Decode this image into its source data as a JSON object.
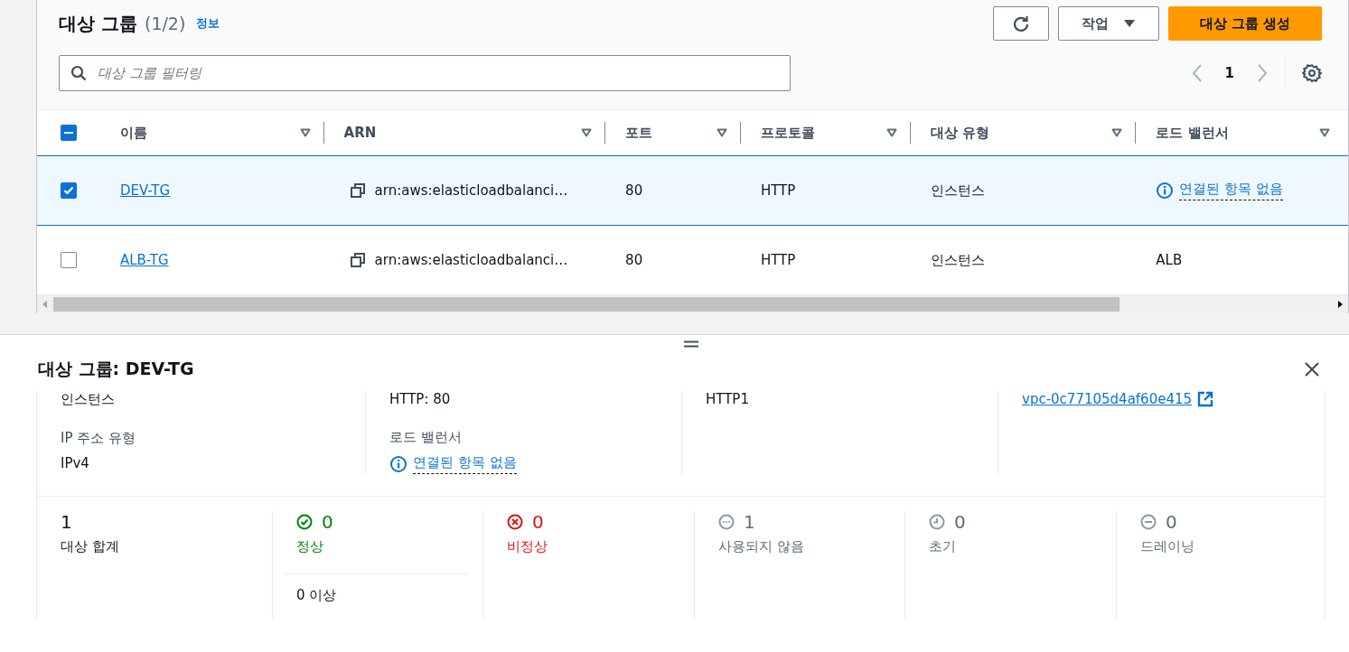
{
  "header": {
    "title": "대상 그룹",
    "count": "(1/2)",
    "info": "정보",
    "actions_button": "작업",
    "create_button": "대상 그룹 생성"
  },
  "filter": {
    "placeholder": "대상 그룹 필터링"
  },
  "pagination": {
    "page": "1",
    "prev_disabled": true,
    "next_disabled": true
  },
  "table": {
    "select_all": {
      "indeterminate": true
    },
    "columns": [
      "이름",
      "ARN",
      "포트",
      "프로토콜",
      "대상 유형",
      "로드 밸런서"
    ],
    "rows": [
      {
        "selected": true,
        "name": "DEV-TG",
        "arn": "arn:aws:elasticloadbalanci…",
        "port": "80",
        "protocol": "HTTP",
        "target_type": "인스턴스",
        "load_balancer": {
          "kind": "info-link",
          "text": "연결된 항목 없음"
        }
      },
      {
        "selected": false,
        "name": "ALB-TG",
        "arn": "arn:aws:elasticloadbalanci…",
        "port": "80",
        "protocol": "HTTP",
        "target_type": "인스턴스",
        "load_balancer": {
          "kind": "text",
          "text": "ALB"
        }
      }
    ]
  },
  "details": {
    "title": "대상 그룹: DEV-TG",
    "columns": [
      [
        {
          "kind": "text",
          "value": "인스턴스"
        },
        {
          "kind": "text",
          "label": "IP 주소 유형",
          "value": "IPv4"
        }
      ],
      [
        {
          "kind": "text",
          "value": "HTTP: 80"
        },
        {
          "kind": "info-link",
          "label": "로드 밸런서",
          "value": "연결된 항목 없음"
        }
      ],
      [
        {
          "kind": "text",
          "value": "HTTP1"
        }
      ],
      [
        {
          "kind": "external-link",
          "value": "vpc-0c77105d4af60e415"
        }
      ]
    ],
    "stats": [
      {
        "kind": "total",
        "value": "1",
        "label": "대상 합계"
      },
      {
        "kind": "healthy",
        "value": "0",
        "label": "정상",
        "sub": "0 이상"
      },
      {
        "kind": "unhealthy",
        "value": "0",
        "label": "비정상"
      },
      {
        "kind": "unused",
        "value": "1",
        "label": "사용되지 않음"
      },
      {
        "kind": "initial",
        "value": "0",
        "label": "초기"
      },
      {
        "kind": "draining",
        "value": "0",
        "label": "드레이닝"
      }
    ]
  }
}
